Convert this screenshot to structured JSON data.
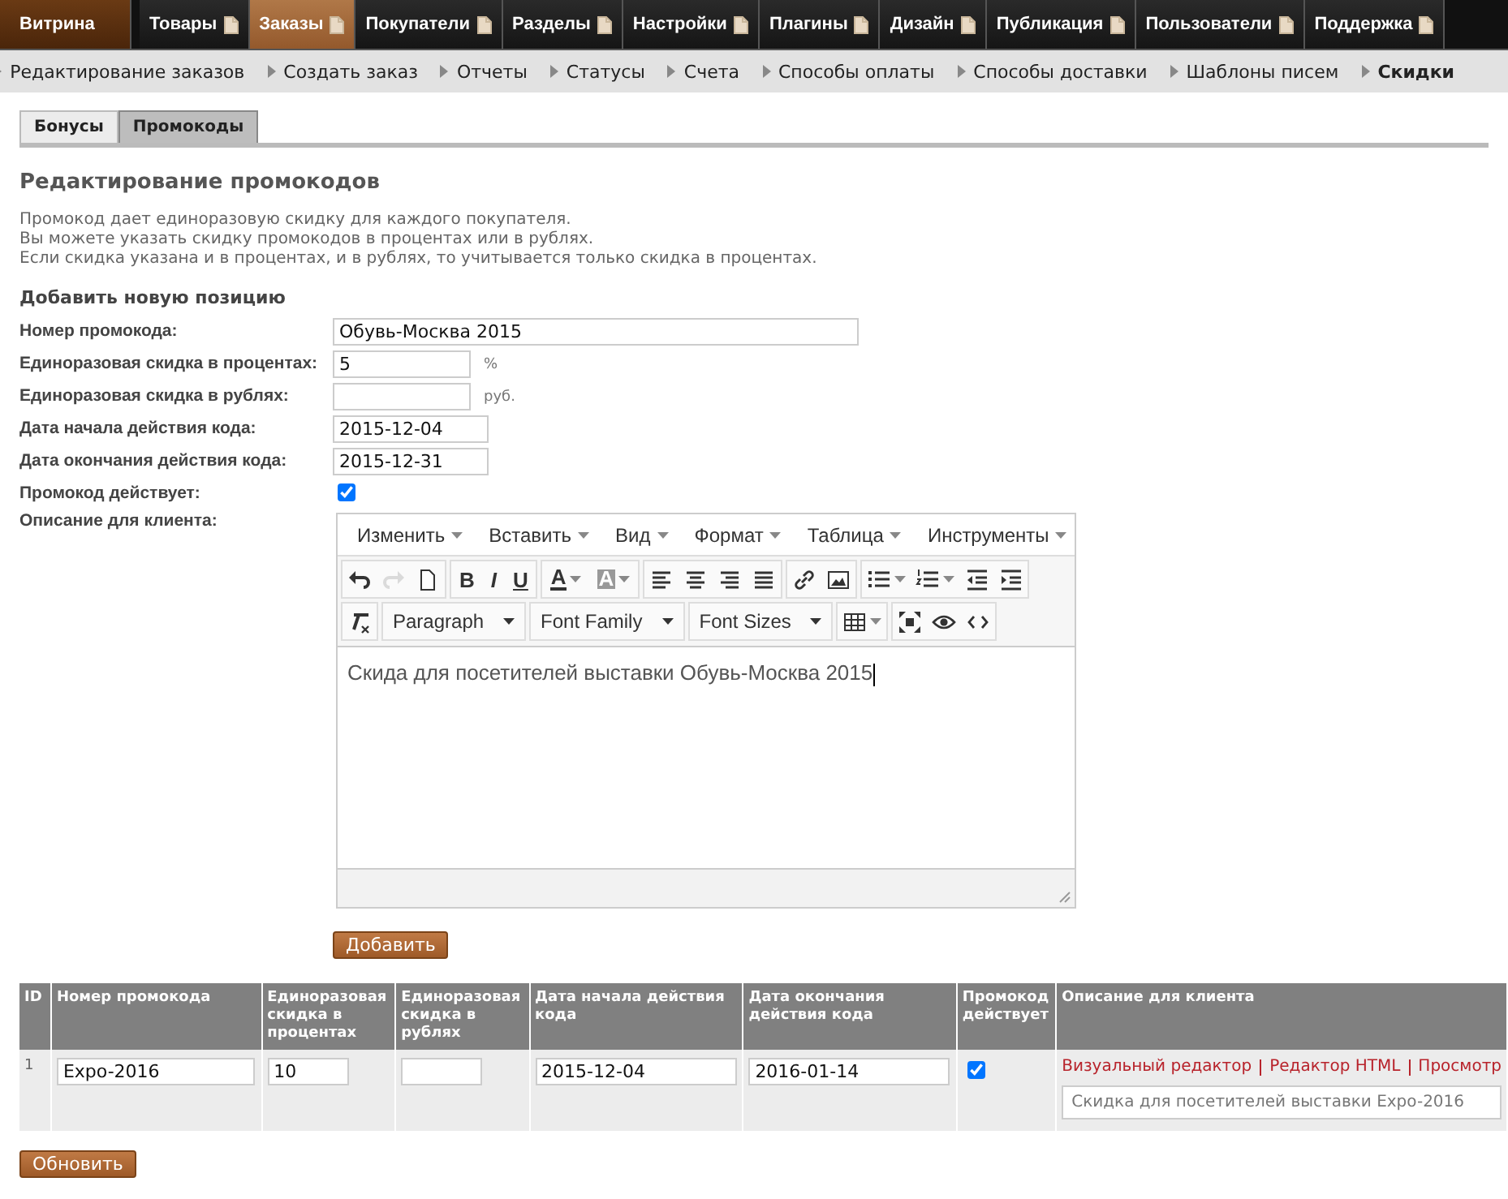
{
  "main_nav": [
    {
      "label": "Витрина",
      "kind": "home",
      "selected": false
    },
    {
      "label": "Товары",
      "kind": "section",
      "selected": false
    },
    {
      "label": "Заказы",
      "kind": "section",
      "selected": true
    },
    {
      "label": "Покупатели",
      "kind": "section",
      "selected": false
    },
    {
      "label": "Разделы",
      "kind": "section",
      "selected": false
    },
    {
      "label": "Настройки",
      "kind": "section",
      "selected": false
    },
    {
      "label": "Плагины",
      "kind": "section",
      "selected": false
    },
    {
      "label": "Дизайн",
      "kind": "section",
      "selected": false
    },
    {
      "label": "Публикация",
      "kind": "section",
      "selected": false
    },
    {
      "label": "Пользователи",
      "kind": "section",
      "selected": false
    },
    {
      "label": "Поддержка",
      "kind": "section",
      "selected": false
    }
  ],
  "sub_nav": [
    {
      "label": "Редактирование заказов",
      "selected": false
    },
    {
      "label": "Создать заказ",
      "selected": false
    },
    {
      "label": "Отчеты",
      "selected": false
    },
    {
      "label": "Статусы",
      "selected": false
    },
    {
      "label": "Счета",
      "selected": false
    },
    {
      "label": "Способы оплаты",
      "selected": false
    },
    {
      "label": "Способы доставки",
      "selected": false
    },
    {
      "label": "Шаблоны писем",
      "selected": false
    },
    {
      "label": "Скидки",
      "selected": true
    }
  ],
  "tabs": [
    {
      "label": "Бонусы",
      "selected": false
    },
    {
      "label": "Промокоды",
      "selected": true
    }
  ],
  "title": "Редактирование промокодов",
  "intro": [
    "Промокод дает единоразовую скидку для каждого покупателя.",
    "Вы можете указать скидку промокодов в процентах или в рублях.",
    "Если скидка указана и в процентах, и в рублях, то учитывается только скидка в процентах."
  ],
  "form_title": "Добавить новую позицию",
  "form": [
    {
      "kind": "text",
      "label": "Номер промокода:",
      "value": "Обувь-Москва 2015"
    },
    {
      "kind": "text",
      "label": "Единоразовая скидка в процентах:",
      "value": "5",
      "unit": "%"
    },
    {
      "kind": "text",
      "label": "Единоразовая скидка в рублях:",
      "unit": "руб."
    },
    {
      "kind": "text",
      "label": "Дата начала действия кода:",
      "value": "2015-12-04"
    },
    {
      "kind": "text",
      "label": "Дата окончания действия кода:",
      "value": "2015-12-31"
    },
    {
      "kind": "checkbox",
      "label": "Промокод действует:",
      "checked": true
    },
    {
      "kind": "editor",
      "label": "Описание для клиента:"
    }
  ],
  "editor": {
    "menus": [
      "Изменить",
      "Вставить",
      "Вид",
      "Формат",
      "Таблица",
      "Инструменты"
    ],
    "toolbar_rows": [
      [
        [
          {
            "kind": "icon",
            "disabled": false,
            "caret": false
          },
          {
            "kind": "icon",
            "disabled": true,
            "caret": false
          },
          {
            "kind": "icon",
            "disabled": false,
            "caret": false
          }
        ],
        [
          {
            "kind": "text",
            "label": "B",
            "caret": false
          },
          {
            "kind": "text",
            "label": "I",
            "caret": false
          },
          {
            "kind": "text",
            "label": "U",
            "caret": false
          }
        ],
        [
          {
            "kind": "text",
            "label": "A",
            "caret": true
          },
          {
            "kind": "text",
            "label": "A",
            "caret": true
          }
        ],
        [
          {
            "kind": "icon",
            "disabled": false,
            "caret": false
          },
          {
            "kind": "icon",
            "disabled": false,
            "caret": false
          },
          {
            "kind": "icon",
            "disabled": false,
            "caret": false
          },
          {
            "kind": "icon",
            "disabled": false,
            "caret": false
          }
        ],
        [
          {
            "kind": "icon",
            "disabled": false,
            "caret": false
          },
          {
            "kind": "icon",
            "disabled": false,
            "caret": false
          }
        ],
        [
          {
            "kind": "icon",
            "disabled": false,
            "caret": true
          },
          {
            "kind": "icon",
            "disabled": false,
            "caret": true
          },
          {
            "kind": "icon",
            "disabled": false,
            "caret": false
          },
          {
            "kind": "icon",
            "disabled": false,
            "caret": false
          }
        ]
      ],
      [
        [
          {
            "kind": "icon",
            "disabled": false,
            "caret": false
          }
        ],
        [
          {
            "kind": "select",
            "label": "Paragraph"
          }
        ],
        [
          {
            "kind": "select",
            "label": "Font Family"
          }
        ],
        [
          {
            "kind": "select",
            "label": "Font Sizes"
          }
        ],
        [
          {
            "kind": "icon",
            "disabled": false,
            "caret": true
          }
        ],
        [
          {
            "kind": "icon",
            "disabled": false,
            "caret": false
          },
          {
            "kind": "icon",
            "disabled": false,
            "caret": false
          },
          {
            "kind": "icon",
            "disabled": false,
            "caret": false
          }
        ]
      ]
    ],
    "content": "Скида для посетителей выставки Обувь-Москва 2015"
  },
  "add_button": "Добавить",
  "table": {
    "columns": [
      "ID",
      "Номер промокода",
      "Единоразовая скидка в процентах",
      "Единоразовая скидка в рублях",
      "Дата начала действия кода",
      "Дата окончания действия кода",
      "Промокод действует",
      "Описание для клиента"
    ],
    "rows": [
      {
        "id": "1",
        "code": "Expo-2016",
        "percent": "10",
        "rubles": "",
        "start": "2015-12-04",
        "end": "2016-01-14",
        "active": true,
        "links": [
          "Визуальный редактор",
          "Редактор HTML",
          "Просмотр"
        ],
        "description": "Скидка для посетителей выставки Expo-2016"
      }
    ]
  },
  "update_button": "Обновить"
}
